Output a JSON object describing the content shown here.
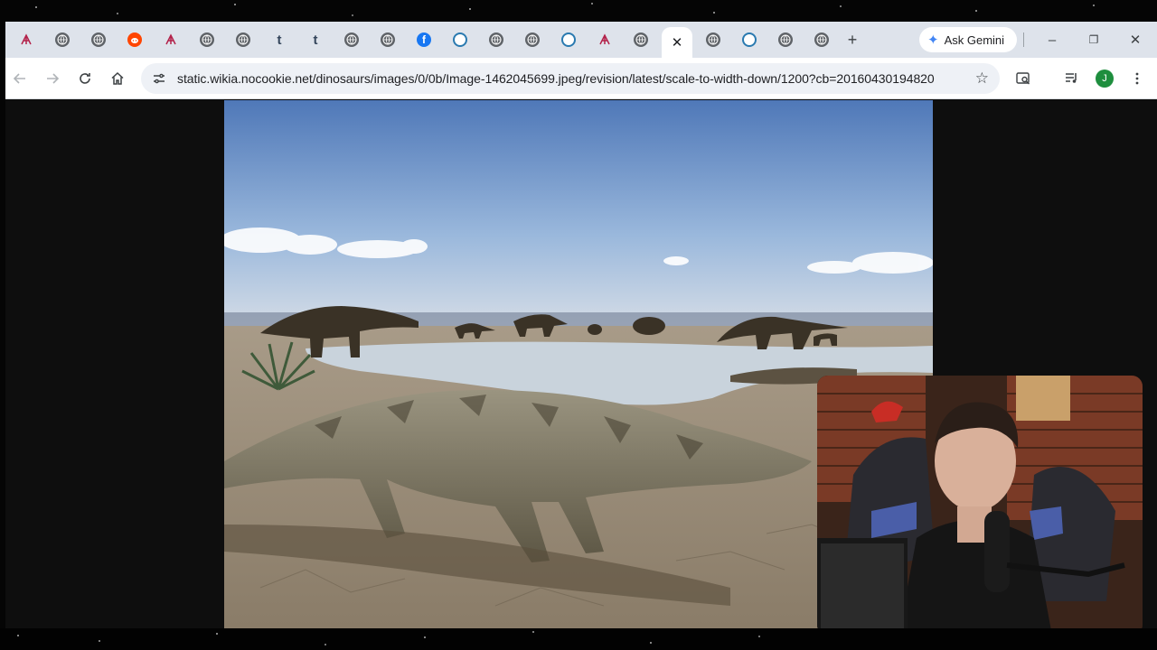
{
  "browser": {
    "tabs": [
      {
        "icon": "wikia-icon",
        "active": false
      },
      {
        "icon": "globe-icon",
        "active": false
      },
      {
        "icon": "globe-icon",
        "active": false
      },
      {
        "icon": "reddit-icon",
        "active": false
      },
      {
        "icon": "wikia-icon",
        "active": false
      },
      {
        "icon": "globe-icon",
        "active": false
      },
      {
        "icon": "globe-icon",
        "active": false
      },
      {
        "icon": "tumblr-icon",
        "active": false
      },
      {
        "icon": "tumblr-icon",
        "active": false
      },
      {
        "icon": "globe-icon",
        "active": false
      },
      {
        "icon": "globe-icon",
        "active": false
      },
      {
        "icon": "facebook-icon",
        "active": false
      },
      {
        "icon": "wikipedia-icon",
        "active": false
      },
      {
        "icon": "globe-icon",
        "active": false
      },
      {
        "icon": "globe-icon",
        "active": false
      },
      {
        "icon": "wikipedia-icon",
        "active": false
      },
      {
        "icon": "wikia-icon",
        "active": false
      },
      {
        "icon": "globe-icon",
        "active": false
      },
      {
        "icon": "close-icon",
        "active": true
      },
      {
        "icon": "globe-icon",
        "active": false
      },
      {
        "icon": "wikipedia-icon",
        "active": false
      },
      {
        "icon": "globe-icon",
        "active": false
      },
      {
        "icon": "globe-icon",
        "active": false
      }
    ],
    "new_tab_icon": "+",
    "gemini_label": "Ask Gemini",
    "window_controls": {
      "minimize": "–",
      "restore": "❐",
      "close": "✕"
    },
    "url": "static.wikia.nocookie.net/dinosaurs/images/0/0b/Image-1462045699.jpeg/revision/latest/scale-to-width-down/1200?cb=20160430194820",
    "avatar_letter": "J",
    "colors": {
      "tabstrip": "#dee3eb",
      "toolbar": "#ffffff",
      "omnibox": "#eef1f6",
      "avatar": "#1e8e3e"
    }
  },
  "content": {
    "image_subject": "prehistoric crocodile-like reptile walking on cracked mud with sauropod dinosaurs by a lake",
    "webcam_overlay": "streamer webcam in bottom-right corner"
  }
}
